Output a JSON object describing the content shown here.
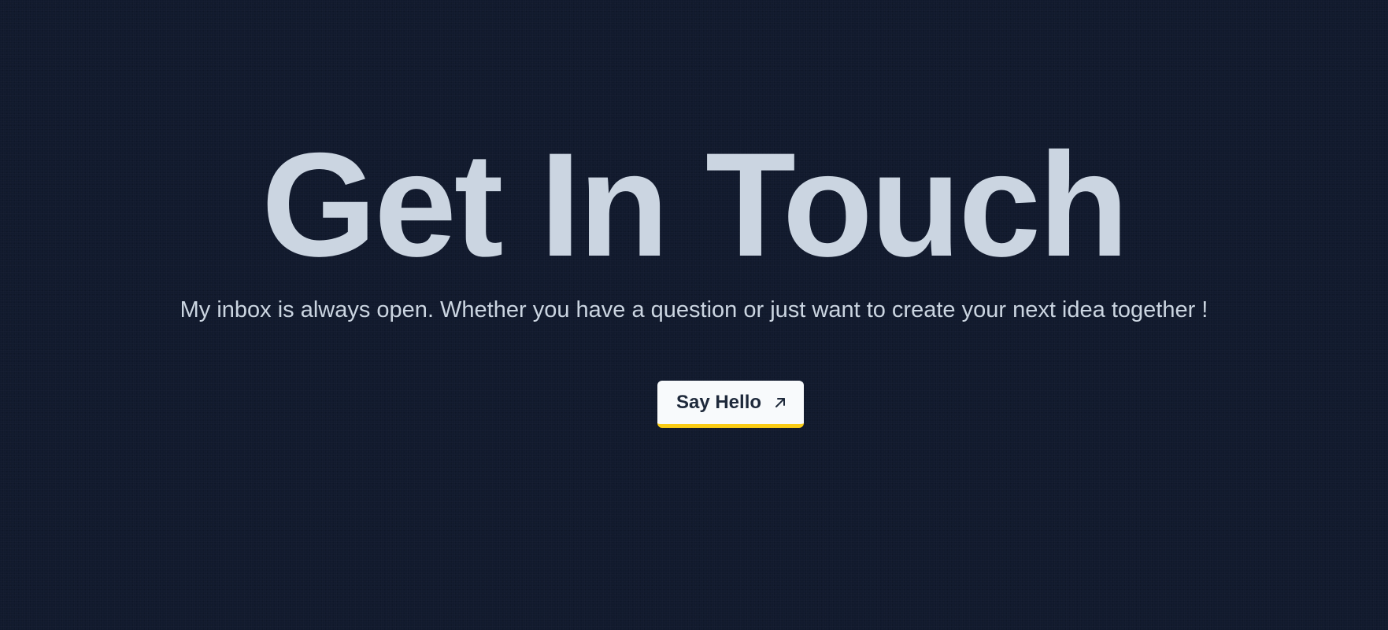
{
  "contact": {
    "heading": "Get In Touch",
    "subtitle": "My inbox is always open. Whether you have a question or just want to create your next idea together !",
    "button_label": "Say Hello",
    "button_icon": "arrow-up-right-icon"
  },
  "colors": {
    "background": "#111a2d",
    "text": "#cbd5e1",
    "button_bg": "#f8fafc",
    "button_text": "#1e293b",
    "button_accent": "#facc15"
  }
}
